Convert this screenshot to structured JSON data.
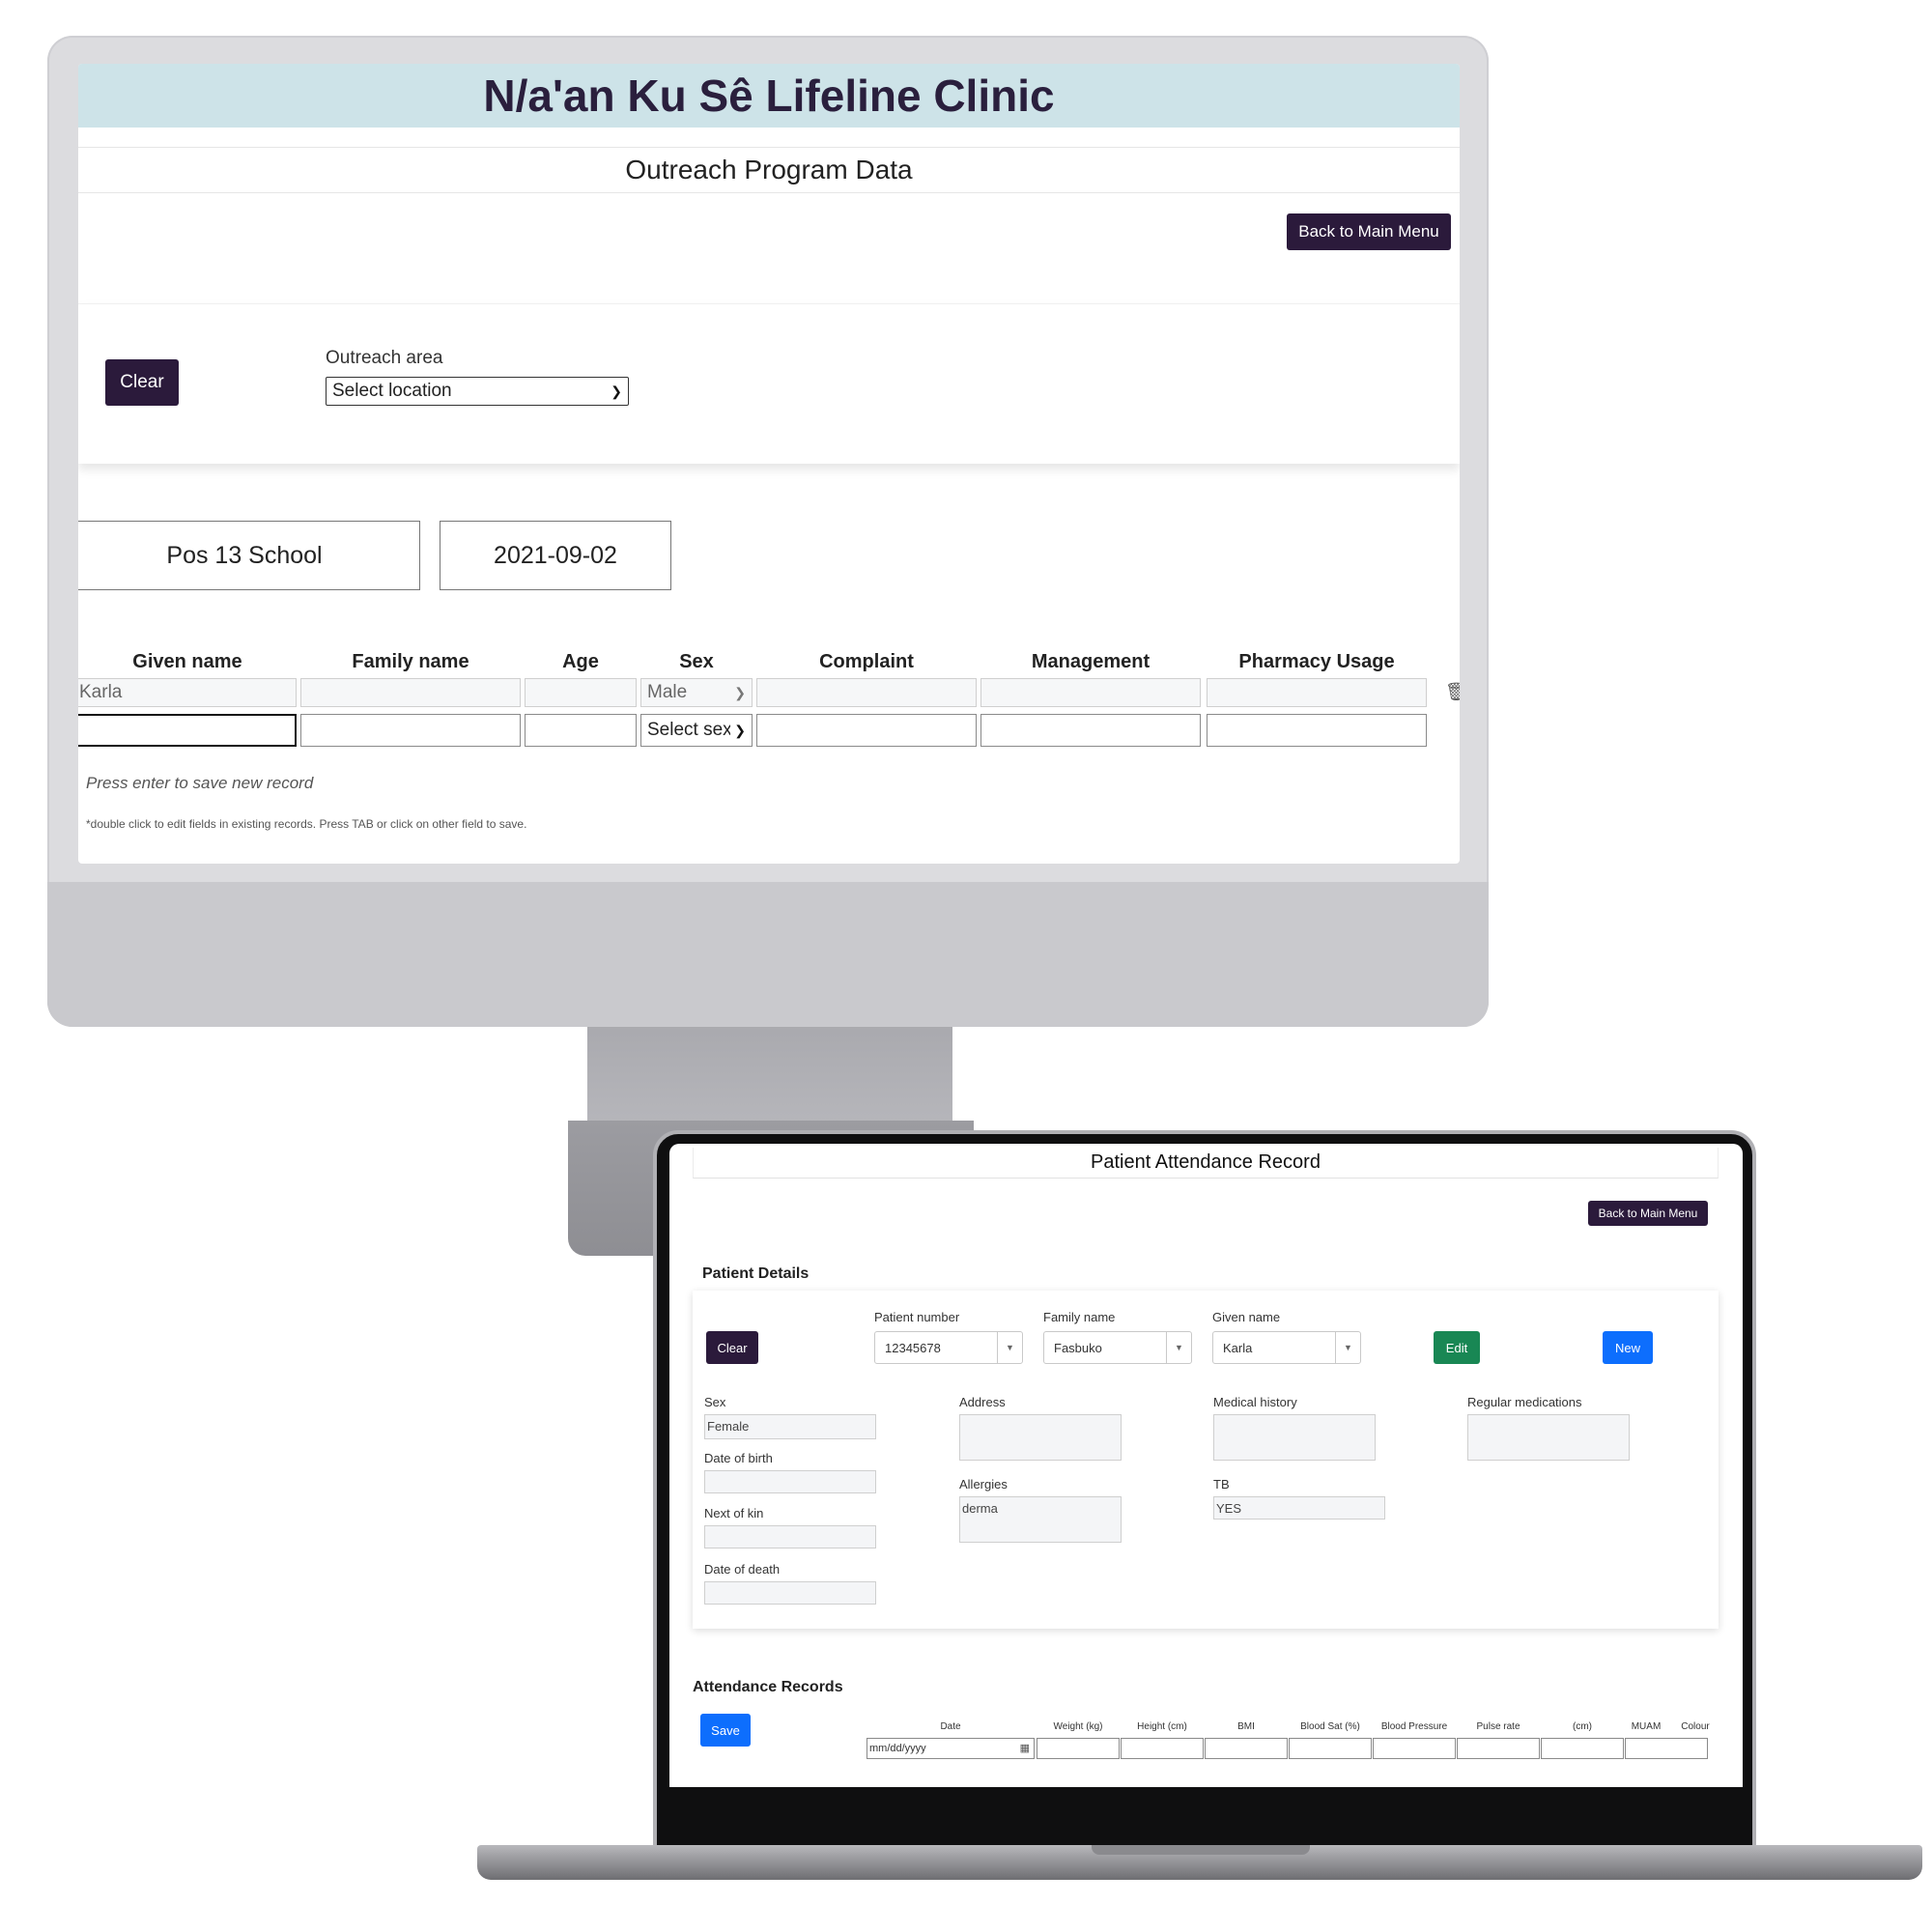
{
  "outreach_screen": {
    "title": "N/a'an Ku Sê Lifeline Clinic",
    "subtitle": "Outreach Program Data",
    "back_button": "Back to Main Menu",
    "clear_button": "Clear",
    "area_label": "Outreach area",
    "area_select_value": "Select location",
    "location": "Pos 13 School",
    "date": "2021-09-02",
    "columns": [
      "Given name",
      "Family name",
      "Age",
      "Sex",
      "Complaint",
      "Management",
      "Pharmacy Usage"
    ],
    "record_row": {
      "given_name": "Karla",
      "family_name": "",
      "age": "",
      "sex": "Male",
      "complaint": "",
      "management": "",
      "pharmacy_usage": ""
    },
    "new_row": {
      "sex_placeholder": "Select sex"
    },
    "hint": "Press enter to save new record",
    "note": "*double click to edit fields in existing records. Press TAB or click on other field to save."
  },
  "attendance_screen": {
    "title": "Patient Attendance Record",
    "back_button": "Back to Main Menu",
    "patient_details_heading": "Patient Details",
    "clear_button": "Clear",
    "patient_number_label": "Patient number",
    "patient_number": "12345678",
    "family_name_label": "Family name",
    "family_name": "Fasbuko",
    "given_name_label": "Given name",
    "given_name": "Karla",
    "edit_button": "Edit",
    "new_button": "New",
    "sex_label": "Sex",
    "sex": "Female",
    "dob_label": "Date of birth",
    "dob": "",
    "next_of_kin_label": "Next of kin",
    "next_of_kin": "",
    "date_of_death_label": "Date of death",
    "date_of_death": "",
    "address_label": "Address",
    "address": "",
    "allergies_label": "Allergies",
    "allergies": "derma",
    "medical_history_label": "Medical history",
    "medical_history": "",
    "tb_label": "TB",
    "tb": "YES",
    "regular_medications_label": "Regular medications",
    "regular_medications": "",
    "attendance_heading": "Attendance Records",
    "save_button": "Save",
    "attendance_columns": [
      "Date",
      "Weight (kg)",
      "Height (cm)",
      "BMI",
      "Blood Sat (%)",
      "Blood Pressure",
      "Pulse rate",
      "(cm)",
      "MUAM",
      "Colour"
    ],
    "date_placeholder": "mm/dd/yyyy"
  }
}
